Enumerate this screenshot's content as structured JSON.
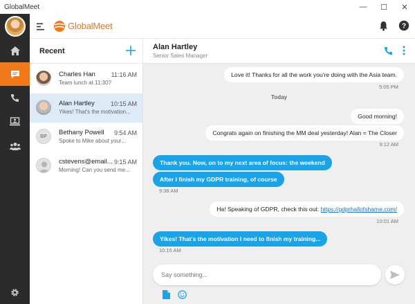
{
  "window": {
    "title": "GlobalMeet",
    "controls": [
      "—",
      "☐",
      "✕"
    ]
  },
  "brand": {
    "name": "GlobalMeet",
    "accent": "#f07a1a",
    "blue": "#1aa3e6"
  },
  "rail": {
    "items": [
      "home-icon",
      "chat-icon",
      "phone-icon",
      "meeting-icon",
      "contacts-icon",
      "settings-icon"
    ],
    "active": "chat-icon"
  },
  "list": {
    "title": "Recent",
    "conversations": [
      {
        "name": "Charles Han",
        "time": "11:16 AM",
        "preview": "Team lunch at 11:30?",
        "avatar": "photo"
      },
      {
        "name": "Alan Hartley",
        "time": "10:15 AM",
        "preview": "Yikes! That's the motivation...",
        "avatar": "photo",
        "selected": true
      },
      {
        "name": "Bethany Powell",
        "time": "9:54 AM",
        "preview": "Spoke to Mike about your...",
        "avatar": "BP"
      },
      {
        "name": "cstevens@email...",
        "time": "9:15 AM",
        "preview": "Morning! Can you send me...",
        "avatar": "generic"
      }
    ]
  },
  "chat": {
    "contact_name": "Alan Hartley",
    "contact_role": "Senior Sales Manager",
    "day_separator": "Today",
    "messages": [
      {
        "dir": "in",
        "text": "Love it! Thanks for all the work you're doing with the Asia team.",
        "time": "5:05 PM"
      },
      {
        "dir": "in",
        "text": "Good morning!"
      },
      {
        "dir": "in",
        "text": "Congrats again on finishing the MM deal yesterday! Alan = The Closer",
        "time": "9:12 AM"
      },
      {
        "dir": "out",
        "text": "Thank you. Now, on to my next area of focus: the weekend"
      },
      {
        "dir": "out",
        "text": "After I finish my GDPR training, of course",
        "time": "9:38 AM"
      },
      {
        "dir": "in",
        "text_before": "Ha! Speaking of GDPR, check this out: ",
        "link": "https://gdprhallofshame.com/",
        "time": "10:01 AM"
      },
      {
        "dir": "out",
        "text": "Yikes! That's the motivation I need to finish my training...",
        "time": "10:15 AM"
      }
    ],
    "composer_placeholder": "Say something..."
  }
}
